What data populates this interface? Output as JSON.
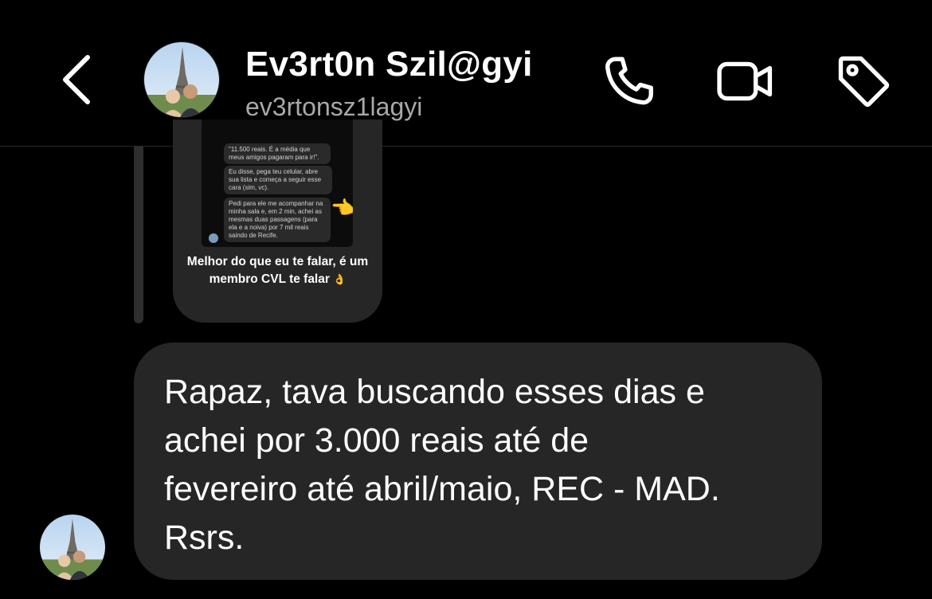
{
  "header": {
    "back_icon": "chevron-left-icon",
    "contact_name": "Ev3rt0n Szil@gyi",
    "contact_handle": "ev3rtonsz1lagyi",
    "actions": [
      {
        "icon": "phone-icon"
      },
      {
        "icon": "video-camera-icon"
      },
      {
        "icon": "tag-icon"
      }
    ]
  },
  "shared_post": {
    "bubbles": [
      "\"11.500 reais. É a média que meus amigos pagaram para ir!\".",
      "Eu disse, pega teu celular, abre sua lista e começa a seguir esse cara (sim, vc).",
      "Pedi para ele me acompanhar na minha sala e, em 2 min, achei as mesmas duas passagens (para ela e a noiva) por 7 mil reais saindo de Recife."
    ],
    "hand_emoji": "👈",
    "caption": "Melhor do que eu te falar, é um membro CVL te falar",
    "caption_emoji": "👌"
  },
  "message": {
    "text": "Rapaz, tava buscando esses dias e\nachei por 3.000 reais até de\nfevereiro até abril/maio, REC - MAD.\nRsrs."
  },
  "colors": {
    "background": "#000000",
    "bubble": "#262626",
    "secondary_text": "#a8a8a8"
  }
}
